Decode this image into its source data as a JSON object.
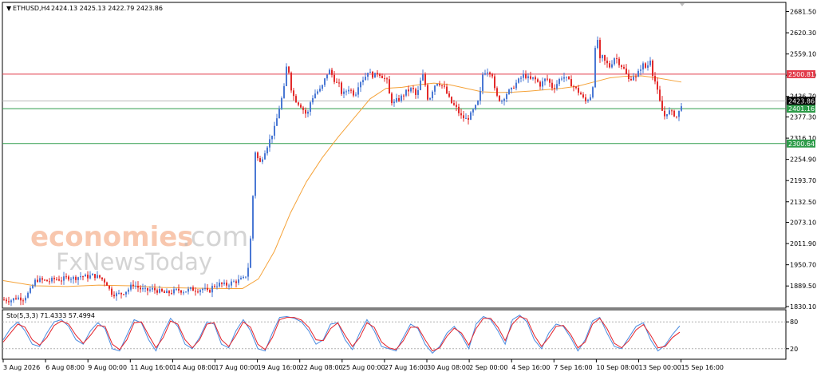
{
  "header": {
    "symbol": "ETHUSD,H4",
    "ohlc": "2424.13 2425.13 2422.79 2423.86"
  },
  "watermark": {
    "line1a": "economies",
    "line1b": ".com",
    "line2": "FxNewsToday"
  },
  "colors": {
    "bull": "#4a78d4",
    "bear": "#e32a2a",
    "ma": "#f5a33a",
    "resistance": "#e23b4a",
    "support": "#2e9c4a",
    "stoch_main": "#4a8be0",
    "stoch_signal": "#e3222a"
  },
  "chart_data": [
    {
      "type": "candlestick",
      "title": "ETHUSD,H4",
      "ylim": [
        1830.1,
        2681.5
      ],
      "y_ticks": [
        "2681.50",
        "2620.30",
        "2559.10",
        "2497.90",
        "2436.70",
        "2377.30",
        "2316.10",
        "2254.90",
        "2193.70",
        "2132.50",
        "2073.10",
        "2011.90",
        "1950.70",
        "1889.50",
        "1830.10"
      ],
      "x_ticks": [
        "3 Aug 2026",
        "6 Aug 08:00",
        "9 Aug 00:00",
        "11 Aug 16:00",
        "14 Aug 08:00",
        "17 Aug 00:00",
        "19 Aug 16:00",
        "22 Aug 08:00",
        "25 Aug 00:00",
        "27 Aug 16:00",
        "30 Aug 08:00",
        "2 Sep 00:00",
        "4 Sep 16:00",
        "7 Sep 16:00",
        "10 Sep 08:00",
        "13 Sep 00:00",
        "15 Sep 16:00"
      ],
      "levels": [
        {
          "label": "2500.81",
          "value": 2500.81,
          "kind": "resistance"
        },
        {
          "label": "2401.16",
          "value": 2401.16,
          "kind": "support"
        },
        {
          "label": "2300.64",
          "value": 2300.64,
          "kind": "support"
        }
      ],
      "current_price": {
        "label": "2423.86",
        "value": 2423.86
      },
      "close_path": [
        [
          0,
          1850
        ],
        [
          8,
          1848
        ],
        [
          16,
          1856
        ],
        [
          24,
          1853
        ],
        [
          32,
          1872
        ],
        [
          40,
          1908
        ],
        [
          48,
          1906
        ],
        [
          56,
          1903
        ],
        [
          64,
          1910
        ],
        [
          72,
          1908
        ],
        [
          80,
          1915
        ],
        [
          88,
          1912
        ],
        [
          96,
          1918
        ],
        [
          104,
          1916
        ],
        [
          112,
          1920
        ],
        [
          120,
          1914
        ],
        [
          128,
          1900
        ],
        [
          134,
          1870
        ],
        [
          140,
          1865
        ],
        [
          148,
          1868
        ],
        [
          156,
          1880
        ],
        [
          162,
          1895
        ],
        [
          170,
          1882
        ],
        [
          178,
          1876
        ],
        [
          186,
          1880
        ],
        [
          194,
          1875
        ],
        [
          202,
          1868
        ],
        [
          210,
          1872
        ],
        [
          218,
          1878
        ],
        [
          226,
          1874
        ],
        [
          234,
          1880
        ],
        [
          242,
          1878
        ],
        [
          250,
          1882
        ],
        [
          256,
          1870
        ],
        [
          262,
          1890
        ],
        [
          270,
          1895
        ],
        [
          278,
          1892
        ],
        [
          286,
          1900
        ],
        [
          294,
          1905
        ],
        [
          302,
          1912
        ],
        [
          308,
          1960
        ],
        [
          310,
          2090
        ],
        [
          312,
          2150
        ],
        [
          314,
          2280
        ],
        [
          316,
          2275
        ],
        [
          320,
          2240
        ],
        [
          324,
          2262
        ],
        [
          328,
          2285
        ],
        [
          332,
          2305
        ],
        [
          336,
          2328
        ],
        [
          340,
          2350
        ],
        [
          344,
          2395
        ],
        [
          348,
          2430
        ],
        [
          352,
          2470
        ],
        [
          354,
          2520
        ],
        [
          356,
          2525
        ],
        [
          360,
          2460
        ],
        [
          364,
          2430
        ],
        [
          368,
          2420
        ],
        [
          372,
          2410
        ],
        [
          376,
          2395
        ],
        [
          380,
          2380
        ],
        [
          384,
          2420
        ],
        [
          388,
          2440
        ],
        [
          392,
          2450
        ],
        [
          396,
          2455
        ],
        [
          400,
          2470
        ],
        [
          404,
          2500
        ],
        [
          408,
          2510
        ],
        [
          412,
          2495
        ],
        [
          416,
          2475
        ],
        [
          420,
          2470
        ],
        [
          424,
          2440
        ],
        [
          428,
          2450
        ],
        [
          432,
          2460
        ],
        [
          436,
          2450
        ],
        [
          440,
          2440
        ],
        [
          444,
          2470
        ],
        [
          448,
          2485
        ],
        [
          452,
          2490
        ],
        [
          456,
          2510
        ],
        [
          460,
          2500
        ],
        [
          464,
          2495
        ],
        [
          468,
          2505
        ],
        [
          472,
          2500
        ],
        [
          476,
          2490
        ],
        [
          480,
          2480
        ],
        [
          484,
          2430
        ],
        [
          488,
          2415
        ],
        [
          492,
          2425
        ],
        [
          496,
          2430
        ],
        [
          500,
          2440
        ],
        [
          504,
          2450
        ],
        [
          508,
          2455
        ],
        [
          512,
          2460
        ],
        [
          516,
          2440
        ],
        [
          520,
          2455
        ],
        [
          524,
          2505
        ],
        [
          528,
          2470
        ],
        [
          532,
          2420
        ],
        [
          536,
          2450
        ],
        [
          540,
          2470
        ],
        [
          544,
          2480
        ],
        [
          548,
          2470
        ],
        [
          552,
          2460
        ],
        [
          556,
          2440
        ],
        [
          560,
          2420
        ],
        [
          564,
          2410
        ],
        [
          568,
          2400
        ],
        [
          572,
          2380
        ],
        [
          576,
          2375
        ],
        [
          580,
          2370
        ],
        [
          584,
          2380
        ],
        [
          588,
          2395
        ],
        [
          592,
          2410
        ],
        [
          596,
          2430
        ],
        [
          600,
          2500
        ],
        [
          604,
          2512
        ],
        [
          608,
          2510
        ],
        [
          612,
          2500
        ],
        [
          616,
          2440
        ],
        [
          620,
          2430
        ],
        [
          624,
          2425
        ],
        [
          628,
          2440
        ],
        [
          632,
          2450
        ],
        [
          636,
          2455
        ],
        [
          640,
          2470
        ],
        [
          644,
          2480
        ],
        [
          648,
          2490
        ],
        [
          652,
          2500
        ],
        [
          656,
          2490
        ],
        [
          660,
          2485
        ],
        [
          664,
          2490
        ],
        [
          668,
          2480
        ],
        [
          672,
          2470
        ],
        [
          676,
          2480
        ],
        [
          680,
          2490
        ],
        [
          684,
          2475
        ],
        [
          688,
          2460
        ],
        [
          692,
          2470
        ],
        [
          696,
          2485
        ],
        [
          700,
          2495
        ],
        [
          704,
          2490
        ],
        [
          708,
          2480
        ],
        [
          712,
          2470
        ],
        [
          716,
          2460
        ],
        [
          720,
          2450
        ],
        [
          724,
          2440
        ],
        [
          728,
          2420
        ],
        [
          732,
          2430
        ],
        [
          736,
          2440
        ],
        [
          740,
          2500
        ],
        [
          742,
          2640
        ],
        [
          744,
          2600
        ],
        [
          746,
          2520
        ],
        [
          748,
          2560
        ],
        [
          752,
          2540
        ],
        [
          756,
          2530
        ],
        [
          760,
          2520
        ],
        [
          764,
          2550
        ],
        [
          768,
          2545
        ],
        [
          772,
          2530
        ],
        [
          776,
          2520
        ],
        [
          780,
          2500
        ],
        [
          784,
          2480
        ],
        [
          788,
          2500
        ],
        [
          792,
          2490
        ],
        [
          796,
          2510
        ],
        [
          800,
          2530
        ],
        [
          804,
          2520
        ],
        [
          808,
          2530
        ],
        [
          810,
          2545
        ],
        [
          812,
          2510
        ],
        [
          816,
          2480
        ],
        [
          820,
          2440
        ],
        [
          824,
          2400
        ],
        [
          828,
          2380
        ],
        [
          832,
          2395
        ],
        [
          836,
          2390
        ],
        [
          840,
          2385
        ],
        [
          844,
          2375
        ],
        [
          848,
          2410
        ],
        [
          851,
          2424
        ]
      ],
      "ma_path": [
        [
          0,
          1905
        ],
        [
          40,
          1890
        ],
        [
          80,
          1888
        ],
        [
          120,
          1892
        ],
        [
          160,
          1890
        ],
        [
          200,
          1885
        ],
        [
          240,
          1883
        ],
        [
          280,
          1882
        ],
        [
          300,
          1882
        ],
        [
          320,
          1910
        ],
        [
          340,
          1990
        ],
        [
          360,
          2100
        ],
        [
          380,
          2190
        ],
        [
          400,
          2260
        ],
        [
          420,
          2320
        ],
        [
          440,
          2375
        ],
        [
          460,
          2430
        ],
        [
          480,
          2460
        ],
        [
          500,
          2463
        ],
        [
          520,
          2470
        ],
        [
          540,
          2475
        ],
        [
          560,
          2470
        ],
        [
          580,
          2460
        ],
        [
          600,
          2450
        ],
        [
          620,
          2448
        ],
        [
          640,
          2449
        ],
        [
          660,
          2452
        ],
        [
          680,
          2456
        ],
        [
          700,
          2460
        ],
        [
          720,
          2466
        ],
        [
          740,
          2478
        ],
        [
          760,
          2490
        ],
        [
          780,
          2495
        ],
        [
          800,
          2496
        ],
        [
          820,
          2490
        ],
        [
          850,
          2478
        ]
      ]
    },
    {
      "type": "line",
      "title": "Sto(5,3,3) 71.4333 57.4994",
      "ylim": [
        0,
        100
      ],
      "y_ticks": [
        "80",
        "20"
      ],
      "levels": [
        80,
        20
      ],
      "series": [
        {
          "name": "Sto main",
          "values": [
            40,
            65,
            80,
            60,
            30,
            25,
            55,
            80,
            85,
            70,
            40,
            30,
            60,
            78,
            65,
            20,
            15,
            50,
            85,
            78,
            40,
            15,
            55,
            88,
            70,
            30,
            20,
            45,
            80,
            75,
            30,
            22,
            60,
            85,
            60,
            20,
            15,
            55,
            90,
            92,
            88,
            80,
            60,
            30,
            40,
            75,
            78,
            40,
            18,
            55,
            85,
            60,
            25,
            20,
            15,
            45,
            75,
            65,
            30,
            10,
            25,
            55,
            70,
            50,
            20,
            75,
            92,
            85,
            60,
            30,
            85,
            95,
            80,
            40,
            20,
            55,
            75,
            70,
            45,
            15,
            40,
            82,
            90,
            55,
            25,
            20,
            45,
            70,
            78,
            40,
            15,
            28,
            52,
            71
          ]
        },
        {
          "name": "Sto signal",
          "values": [
            35,
            55,
            75,
            68,
            40,
            28,
            45,
            72,
            82,
            75,
            50,
            32,
            50,
            72,
            70,
            30,
            18,
            40,
            78,
            80,
            50,
            22,
            45,
            82,
            75,
            40,
            22,
            40,
            75,
            78,
            40,
            25,
            50,
            80,
            68,
            30,
            18,
            45,
            85,
            90,
            90,
            84,
            68,
            40,
            38,
            65,
            78,
            50,
            25,
            45,
            78,
            68,
            35,
            22,
            18,
            38,
            68,
            68,
            40,
            15,
            22,
            48,
            66,
            55,
            28,
            65,
            88,
            88,
            68,
            38,
            75,
            92,
            86,
            50,
            25,
            45,
            70,
            72,
            52,
            22,
            35,
            75,
            88,
            65,
            32,
            22,
            38,
            62,
            74,
            50,
            22,
            25,
            45,
            57
          ]
        }
      ]
    }
  ]
}
